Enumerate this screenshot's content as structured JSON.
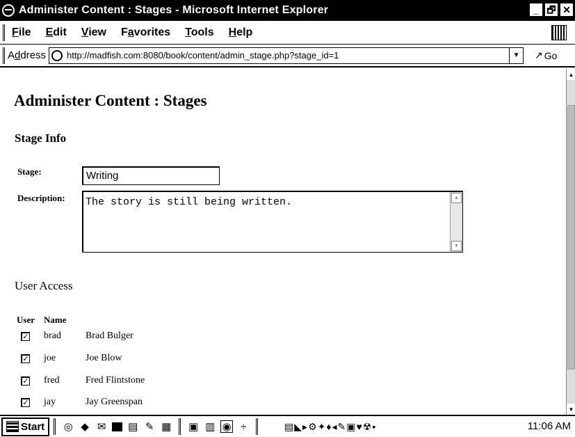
{
  "window": {
    "title": "Administer Content : Stages - Microsoft Internet Explorer",
    "controls": [
      "_",
      "🗗",
      "✕"
    ]
  },
  "menu": [
    {
      "accel": "F",
      "rest": "ile"
    },
    {
      "accel": "E",
      "rest": "dit"
    },
    {
      "accel": "V",
      "rest": "iew"
    },
    {
      "pre": "F",
      "accel": "a",
      "rest": "vorites"
    },
    {
      "accel": "T",
      "rest": "ools"
    },
    {
      "accel": "H",
      "rest": "elp"
    }
  ],
  "address": {
    "label_pre": "A",
    "label_accel": "d",
    "label_rest": "dress",
    "url": "http://madfish.com:8080/book/content/admin_stage.php?stage_id=1",
    "go": "Go"
  },
  "page": {
    "heading": "Administer Content : Stages",
    "stage_info_heading": "Stage Info",
    "stage_label": "Stage:",
    "stage_value": "Writing",
    "description_label": "Description:",
    "description_value": "The story is still being written.",
    "user_access_heading": "User Access",
    "table_headers": [
      "User",
      "Name"
    ],
    "users": [
      {
        "user": "brad",
        "name": "Brad Bulger",
        "checked": true
      },
      {
        "user": "joe",
        "name": "Joe Blow",
        "checked": true
      },
      {
        "user": "fred",
        "name": "Fred Flintstone",
        "checked": true
      },
      {
        "user": "jay",
        "name": "Jay Greenspan",
        "checked": true
      }
    ]
  },
  "taskbar": {
    "start": "Start",
    "clock": "11:06 AM",
    "icons": [
      "ie-icon",
      "media-icon",
      "outlook-icon",
      "desktop-icon",
      "folder-icon",
      "paint-icon",
      "calc-icon",
      "doc-icon",
      "explorer-icon",
      "ie-active-icon",
      "network-icon",
      "tray-icons"
    ]
  }
}
